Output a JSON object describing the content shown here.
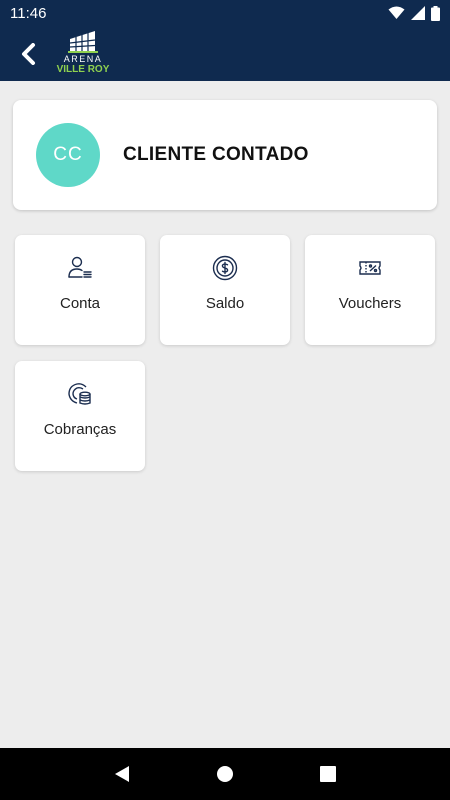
{
  "status_bar": {
    "time": "11:46"
  },
  "header": {
    "logo_top": "ARENA",
    "logo_bottom": "VILLE ROY"
  },
  "profile": {
    "initials": "CC",
    "name": "CLIENTE CONTADO",
    "avatar_color": "#5fd8c8"
  },
  "menu": {
    "items": [
      {
        "label": "Conta",
        "icon": "user-list-icon"
      },
      {
        "label": "Saldo",
        "icon": "dollar-coin-icon"
      },
      {
        "label": "Vouchers",
        "icon": "voucher-icon"
      },
      {
        "label": "Cobranças",
        "icon": "coins-stack-icon"
      }
    ]
  },
  "colors": {
    "header_bg": "#0f2a4f",
    "accent": "#5fd8c8",
    "logo_green": "#8fd14f",
    "background": "#ededed"
  }
}
